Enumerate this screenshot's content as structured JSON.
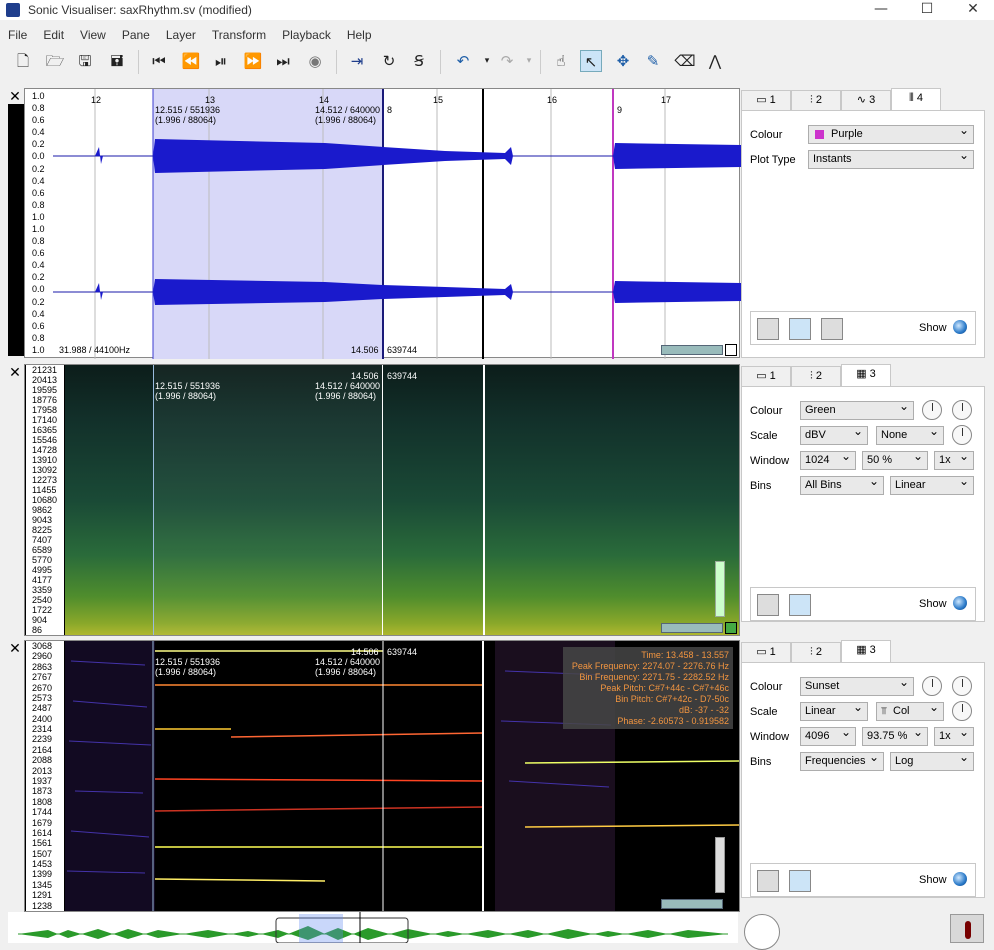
{
  "window": {
    "title": "Sonic Visualiser: saxRhythm.sv (modified)",
    "min": "—",
    "max": "☐",
    "close": "✕"
  },
  "menu": [
    "File",
    "Edit",
    "View",
    "Pane",
    "Layer",
    "Transform",
    "Playback",
    "Help"
  ],
  "toolbar": [
    "new-file-icon",
    "open-icon",
    "save-icon",
    "save-as-icon",
    "rewind-start-icon",
    "rewind-icon",
    "play-pause-icon",
    "fast-forward-icon",
    "fast-forward-end-icon",
    "record-icon",
    "play-selection-icon",
    "loop-icon",
    "solo-icon",
    "undo-icon",
    "redo-icon",
    "navigate-icon",
    "select-icon",
    "move-icon",
    "draw-icon",
    "erase-icon",
    "measure-icon"
  ],
  "timeline": {
    "ticks": [
      "12",
      "13",
      "14",
      "15",
      "16",
      "17"
    ]
  },
  "pane1": {
    "scale_labels_top": [
      "1.0",
      "0.8",
      "0.6",
      "0.4",
      "0.2",
      "0.0",
      "0.2",
      "0.4",
      "0.6",
      "0.8",
      "1.0"
    ],
    "scale_labels_bottom": [
      "1.0",
      "0.8",
      "0.6",
      "0.4",
      "0.2",
      "0.0",
      "0.2",
      "0.4",
      "0.6",
      "0.8",
      "1.0"
    ],
    "sel_start": "12.515 / 551936\n(1.996 / 88064)",
    "sel_end": "14.512 / 640000\n(1.996 / 88064)",
    "marker": "8",
    "marker2": "9",
    "bottom_left": "31.988 / 44100Hz",
    "bottom_mid": "14.506",
    "bottom_right": "639744",
    "tabs": [
      "1",
      "2",
      "3",
      "4"
    ],
    "props": {
      "colour_label": "Colour",
      "colour": "Purple",
      "plot_label": "Plot Type",
      "plot": "Instants",
      "show": "Show"
    },
    "colour_swatch": "#cc33cc"
  },
  "pane2": {
    "scale": [
      "21231",
      "20413",
      "19595",
      "18776",
      "17958",
      "17140",
      "16365",
      "15546",
      "14728",
      "13910",
      "13092",
      "12273",
      "11455",
      "10680",
      "9862",
      "9043",
      "8225",
      "7407",
      "6589",
      "5770",
      "4995",
      "4177",
      "3359",
      "2540",
      "1722",
      "904",
      "86"
    ],
    "sel_start": "12.515 / 551936\n(1.996 / 88064)",
    "sel_end": "14.512 / 640000\n(1.996 / 88064)",
    "cursor_time": "14.506",
    "cursor_frame": "639744",
    "tabs": [
      "1",
      "2",
      "3"
    ],
    "props": {
      "colour_label": "Colour",
      "colour": "Green",
      "scale_label": "Scale",
      "scale": "dBV",
      "scale2": "None",
      "window_label": "Window",
      "window": "1024",
      "overlap": "50 %",
      "zoom": "1x",
      "bins_label": "Bins",
      "bins": "All Bins",
      "binscale": "Linear",
      "show": "Show"
    }
  },
  "pane3": {
    "scale": [
      "3068",
      "2960",
      "2863",
      "2767",
      "2670",
      "2573",
      "2487",
      "2400",
      "2314",
      "2239",
      "2164",
      "2088",
      "2013",
      "1937",
      "1873",
      "1808",
      "1744",
      "1679",
      "1614",
      "1561",
      "1507",
      "1453",
      "1399",
      "1345",
      "1291",
      "1238"
    ],
    "sel_start": "12.515 / 551936\n(1.996 / 88064)",
    "sel_end": "14.512 / 640000\n(1.996 / 88064)",
    "cursor_time": "14.506",
    "cursor_frame": "639744",
    "info": [
      "Time: 13.458 - 13.557",
      "Peak Frequency: 2274.07 - 2276.76 Hz",
      "Bin Frequency: 2271.75 - 2282.52 Hz",
      "Peak Pitch: C#7+44c - C#7+46c",
      "Bin Pitch: C#7+42c - D7-50c",
      "dB: -37 - -32",
      "Phase: -2.60573 - 0.919582"
    ],
    "tabs": [
      "1",
      "2",
      "3"
    ],
    "props": {
      "colour_label": "Colour",
      "colour": "Sunset",
      "scale_label": "Scale",
      "scale": "Linear",
      "scale2": "Col",
      "window_label": "Window",
      "window": "4096",
      "overlap": "93.75 %",
      "zoom": "1x",
      "bins_label": "Bins",
      "bins": "Frequencies",
      "binscale": "Log",
      "show": "Show"
    }
  }
}
